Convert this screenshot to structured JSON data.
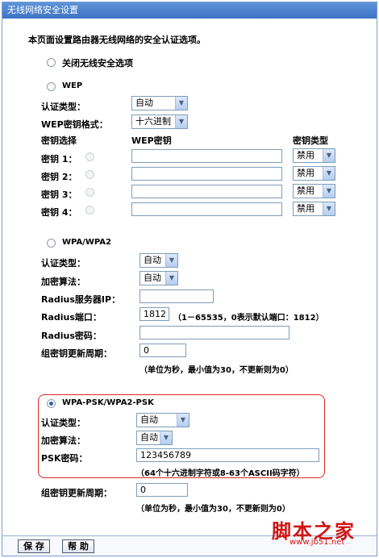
{
  "window": {
    "title": "无线网络安全设置"
  },
  "intro": "本页面设置路由器无线网络的安全认证选项。",
  "disable_option": {
    "label": "关闭无线安全选项",
    "selected": false
  },
  "wep": {
    "label": "WEP",
    "selected": false,
    "auth_type_label": "认证类型：",
    "auth_type_value": "自动",
    "key_format_label": "WEP密钥格式：",
    "key_format_value": "十六进制",
    "col_key_select": "密钥选择",
    "col_wep_key": "WEP密钥",
    "col_key_type": "密钥类型",
    "keys": [
      {
        "label": "密钥 1：",
        "value": "",
        "type": "禁用"
      },
      {
        "label": "密钥 2：",
        "value": "",
        "type": "禁用"
      },
      {
        "label": "密钥 3：",
        "value": "",
        "type": "禁用"
      },
      {
        "label": "密钥 4：",
        "value": "",
        "type": "禁用"
      }
    ]
  },
  "wpa": {
    "label": "WPA/WPA2",
    "selected": false,
    "auth_type_label": "认证类型：",
    "auth_type_value": "自动",
    "encryption_label": "加密算法：",
    "encryption_value": "自动",
    "radius_ip_label": "Radius服务器IP：",
    "radius_ip_value": "",
    "radius_port_label": "Radius端口：",
    "radius_port_value": "1812",
    "radius_port_hint": "（1－65535，0表示默认端口：1812）",
    "radius_pwd_label": "Radius密码：",
    "radius_pwd_value": "",
    "group_key_label": "组密钥更新周期：",
    "group_key_value": "0",
    "group_key_hint": "（单位为秒，最小值为30，不更新则为0）"
  },
  "wpa_psk": {
    "label": "WPA-PSK/WPA2-PSK",
    "selected": true,
    "auth_type_label": "认证类型：",
    "auth_type_value": "自动",
    "encryption_label": "加密算法：",
    "encryption_value": "自动",
    "psk_label": "PSK密码：",
    "psk_value": "123456789",
    "psk_hint": "（64个十六进制字符或8-63个ASCII码字符）",
    "group_key_label": "组密钥更新周期：",
    "group_key_value": "0",
    "group_key_hint": "（单位为秒，最小值为30，不更新则为0）"
  },
  "footer": {
    "save_label": "保 存",
    "help_label": "帮 助"
  },
  "watermark": {
    "text": "脚本之家",
    "url": "www.jb51.net"
  },
  "colors": {
    "title_bar": "#4a80cd",
    "highlight_border": "#d92a2a",
    "watermark": "#d01414"
  }
}
